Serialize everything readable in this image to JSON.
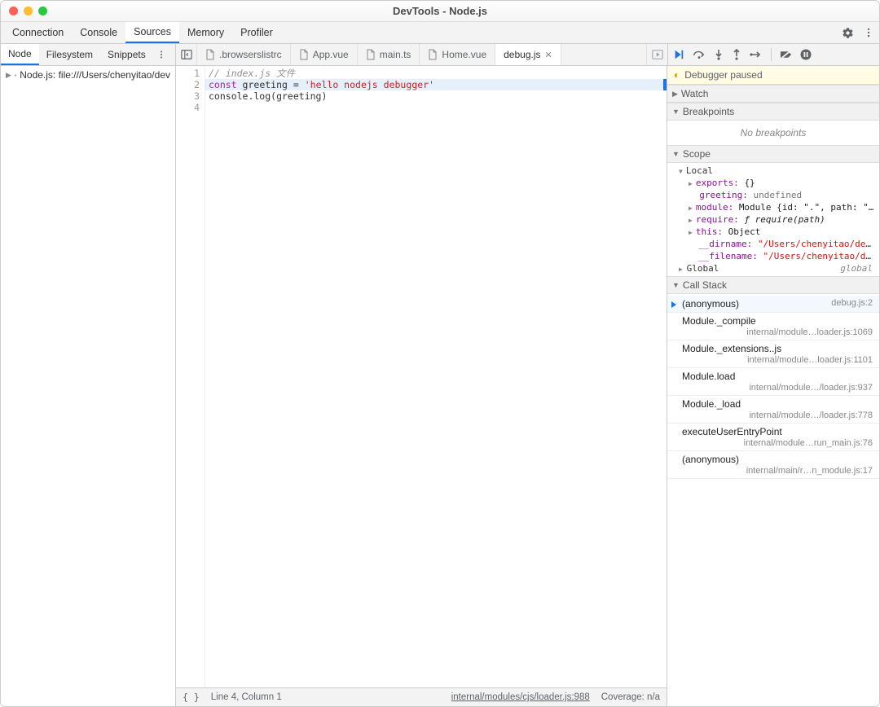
{
  "title": "DevTools - Node.js",
  "toolbar_tabs": [
    "Connection",
    "Console",
    "Sources",
    "Memory",
    "Profiler"
  ],
  "toolbar_active": "Sources",
  "left_subnav": [
    "Node",
    "Filesystem",
    "Snippets"
  ],
  "left_subnav_active": "Node",
  "tree_root": "Node.js: file:///Users/chenyitao/dev",
  "file_tabs": [
    ".browserslistrc",
    "App.vue",
    "main.ts",
    "Home.vue",
    "debug.js"
  ],
  "file_tab_active": "debug.js",
  "code": {
    "1": {
      "type": "comment",
      "text": "// index.js 文件"
    },
    "2": {
      "kw": "const",
      "id": " greeting = ",
      "str": "'hello nodejs debugger'"
    },
    "3": {
      "text": "console.log(greeting)"
    },
    "4": {
      "text": ""
    }
  },
  "statusbar": {
    "pos": "Line 4, Column 1",
    "link": "internal/modules/cjs/loader.js:988",
    "coverage": "Coverage: n/a"
  },
  "debugger_status": "Debugger paused",
  "sections": {
    "watch": "Watch",
    "breakpoints": "Breakpoints",
    "no_breakpoints": "No breakpoints",
    "scope": "Scope",
    "callstack": "Call Stack"
  },
  "scope": {
    "local": "Local",
    "exports_k": "exports:",
    "exports_v": "{}",
    "greeting_k": "greeting:",
    "greeting_v": "undefined",
    "module_k": "module:",
    "module_v": "Module {id: \".\", path: \"/Use…",
    "require_k": "require:",
    "require_v": "ƒ require(path)",
    "this_k": "this:",
    "this_v": "Object",
    "dirname_k": "__dirname:",
    "dirname_v": "\"/Users/chenyitao/dev/pla…",
    "filename_k": "__filename:",
    "filename_v": "\"/Users/chenyitao/dev/pl…",
    "global": "Global",
    "global_tag": "global"
  },
  "callstack": [
    {
      "fn": "(anonymous)",
      "loc": "debug.js:2",
      "active": true
    },
    {
      "fn": "Module._compile",
      "loc": "internal/module…loader.js:1069"
    },
    {
      "fn": "Module._extensions..js",
      "loc": "internal/module…loader.js:1101"
    },
    {
      "fn": "Module.load",
      "loc": "internal/module…/loader.js:937"
    },
    {
      "fn": "Module._load",
      "loc": "internal/module…/loader.js:778"
    },
    {
      "fn": "executeUserEntryPoint",
      "loc": "internal/module…run_main.js:76"
    },
    {
      "fn": "(anonymous)",
      "loc": "internal/main/r…n_module.js:17"
    }
  ]
}
